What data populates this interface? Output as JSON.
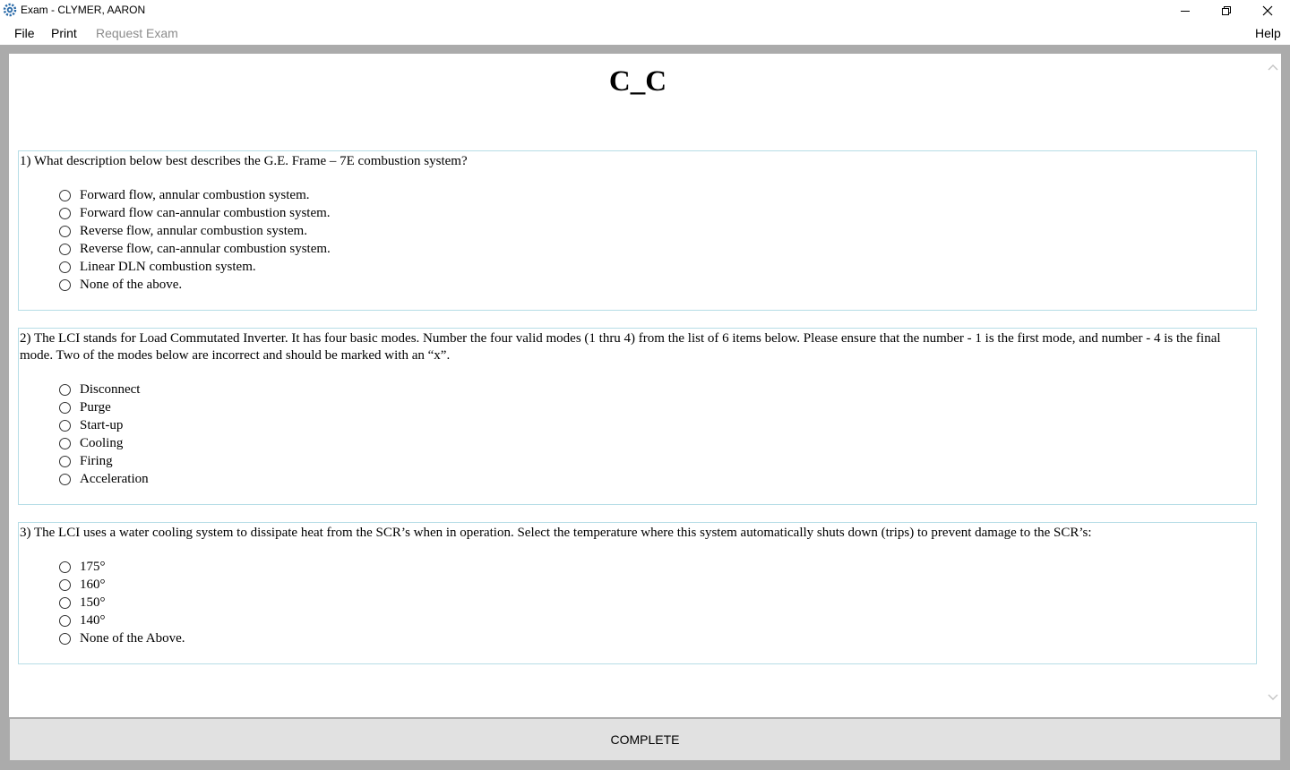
{
  "window": {
    "title": "Exam - CLYMER, AARON",
    "icon": "gear-icon",
    "controls": [
      "minimize-icon",
      "maximize-icon",
      "close-icon"
    ]
  },
  "menu": {
    "file": "File",
    "print": "Print",
    "request_exam": "Request Exam",
    "help": "Help"
  },
  "exam": {
    "title": "C_C"
  },
  "questions": [
    {
      "text": "1) What description below best describes the G.E. Frame – 7E combustion system?",
      "options": [
        "Forward flow, annular combustion system.",
        "Forward flow can-annular combustion system.",
        "Reverse flow, annular combustion system.",
        "Reverse flow, can-annular combustion system.",
        "Linear DLN combustion system.",
        "None of the above."
      ]
    },
    {
      "text": "2) The LCI stands for Load Commutated Inverter. It has four basic modes. Number the four valid modes (1 thru 4) from the list of 6 items below. Please ensure that the number - 1 is the first mode, and number - 4 is the final mode. Two of the modes below are incorrect and should be marked with an “x”.",
      "options": [
        "Disconnect",
        "Purge",
        "Start-up",
        "Cooling",
        "Firing",
        "Acceleration"
      ]
    },
    {
      "text": "3) The LCI uses a water cooling system to dissipate heat from the SCR’s when in operation. Select the temperature where this system automatically shuts down (trips) to prevent damage to the SCR’s:",
      "options": [
        "175°",
        "160°",
        "150°",
        "140°",
        "None of the Above."
      ]
    }
  ],
  "actions": {
    "complete": "COMPLETE"
  }
}
